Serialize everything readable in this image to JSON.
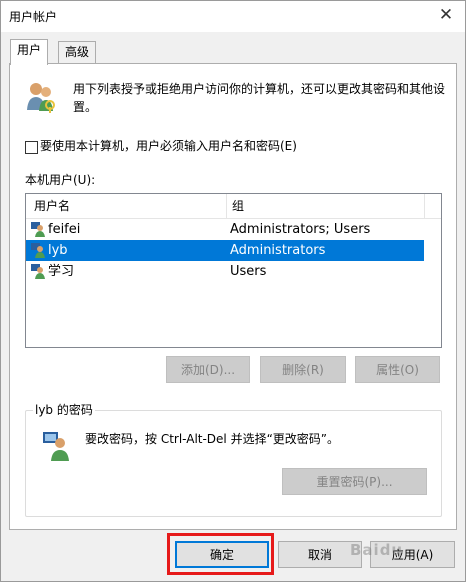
{
  "window": {
    "title": "用户帐户",
    "close_symbol": "✕"
  },
  "tabs": [
    {
      "label": "用户"
    },
    {
      "label": "高级"
    }
  ],
  "info_text": "用下列表授予或拒绝用户访问你的计算机，还可以更改其密码和其他设置。",
  "require_password": {
    "label": "要使用本计算机，用户必须输入用户名和密码(E)",
    "checked": false
  },
  "users_label": "本机用户(U):",
  "table": {
    "headers": [
      "用户名",
      "组"
    ],
    "rows": [
      {
        "name": "feifei",
        "group": "Administrators; Users",
        "selected": false
      },
      {
        "name": "lyb",
        "group": "Administrators",
        "selected": true
      },
      {
        "name": "学习",
        "group": "Users",
        "selected": false
      }
    ]
  },
  "buttons": {
    "add": "添加(D)...",
    "remove": "删除(R)",
    "properties": "属性(O)"
  },
  "password_group": {
    "title": "lyb 的密码",
    "text": "要改密码，按 Ctrl-Alt-Del 并选择“更改密码”。",
    "reset_button": "重置密码(P)..."
  },
  "footer": {
    "ok": "确定",
    "cancel": "取消",
    "apply": "应用(A)"
  },
  "watermark": "Baidu",
  "colors": {
    "selection": "#0078d7",
    "highlight": "#e61a1a"
  }
}
